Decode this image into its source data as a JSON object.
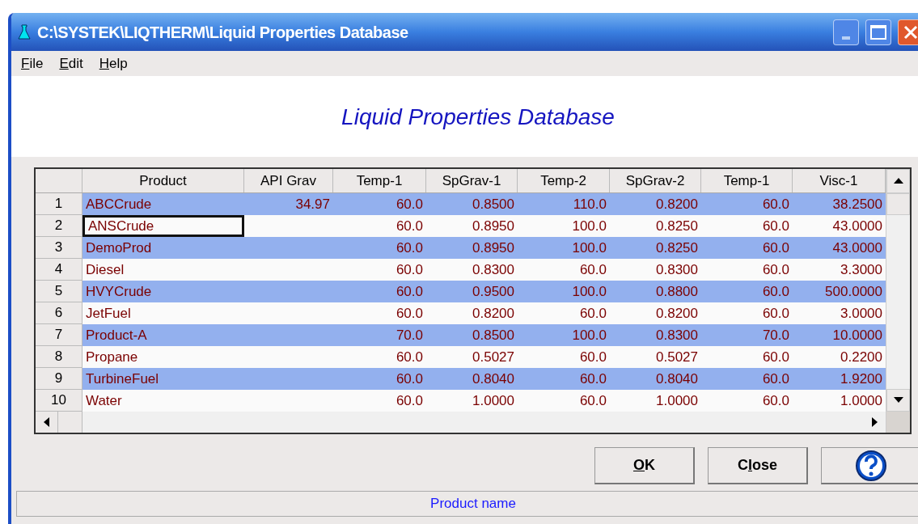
{
  "window": {
    "title": "C:\\SYSTEK\\LIQTHERM\\Liquid Properties Database"
  },
  "menu": [
    {
      "access_key": "F",
      "after": "ile"
    },
    {
      "access_key": "E",
      "after": "dit"
    },
    {
      "access_key": "H",
      "after": "elp"
    }
  ],
  "heading": "Liquid Properties Database",
  "table": {
    "columns": [
      "Product",
      "API Grav",
      "Temp-1",
      "SpGrav-1",
      "Temp-2",
      "SpGrav-2",
      "Temp-1",
      "Visc-1"
    ],
    "rows": [
      {
        "number": "1",
        "cells": [
          "ABCCrude",
          "34.97",
          "60.0",
          "0.8500",
          "110.0",
          "0.8200",
          "60.0",
          "38.2500"
        ],
        "selected": true,
        "focused": false
      },
      {
        "number": "2",
        "cells": [
          "ANSCrude",
          null,
          "60.0",
          "0.8950",
          "100.0",
          "0.8250",
          "60.0",
          "43.0000"
        ],
        "selected": false,
        "focused": true
      },
      {
        "number": "3",
        "cells": [
          "DemoProd",
          null,
          "60.0",
          "0.8950",
          "100.0",
          "0.8250",
          "60.0",
          "43.0000"
        ],
        "selected": true,
        "focused": false
      },
      {
        "number": "4",
        "cells": [
          "Diesel",
          null,
          "60.0",
          "0.8300",
          "60.0",
          "0.8300",
          "60.0",
          "3.3000"
        ],
        "selected": false,
        "focused": false
      },
      {
        "number": "5",
        "cells": [
          "HVYCrude",
          null,
          "60.0",
          "0.9500",
          "100.0",
          "0.8800",
          "60.0",
          "500.0000"
        ],
        "selected": true,
        "focused": false
      },
      {
        "number": "6",
        "cells": [
          "JetFuel",
          null,
          "60.0",
          "0.8200",
          "60.0",
          "0.8200",
          "60.0",
          "3.0000"
        ],
        "selected": false,
        "focused": false
      },
      {
        "number": "7",
        "cells": [
          "Product-A",
          null,
          "70.0",
          "0.8500",
          "100.0",
          "0.8300",
          "70.0",
          "10.0000"
        ],
        "selected": true,
        "focused": false
      },
      {
        "number": "8",
        "cells": [
          "Propane",
          null,
          "60.0",
          "0.5027",
          "60.0",
          "0.5027",
          "60.0",
          "0.2200"
        ],
        "selected": false,
        "focused": false
      },
      {
        "number": "9",
        "cells": [
          "TurbineFuel",
          null,
          "60.0",
          "0.8040",
          "60.0",
          "0.8040",
          "60.0",
          "1.9200"
        ],
        "selected": true,
        "focused": false
      },
      {
        "number": "10",
        "cells": [
          "Water",
          null,
          "60.0",
          "1.0000",
          "60.0",
          "1.0000",
          "60.0",
          "1.0000"
        ],
        "selected": false,
        "focused": false
      }
    ]
  },
  "buttons": [
    {
      "kind": "text",
      "access_key": "O",
      "after": "K"
    },
    {
      "kind": "text",
      "before": "C",
      "access_key": "l",
      "after": "ose"
    },
    {
      "kind": "help"
    }
  ],
  "status_bar": "Product name"
}
